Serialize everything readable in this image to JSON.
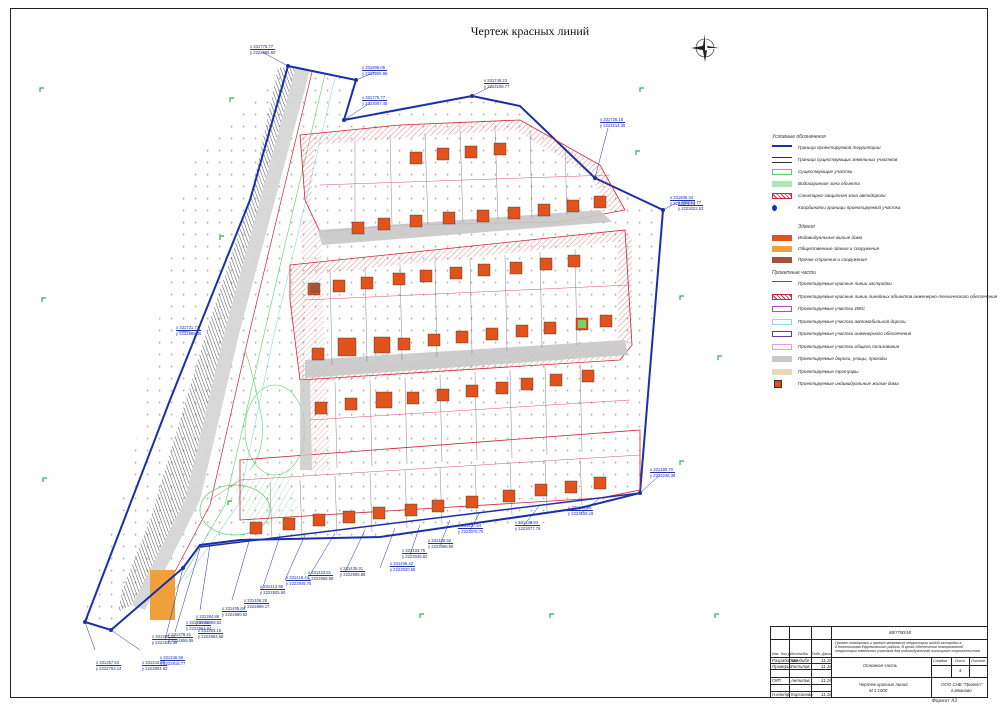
{
  "title": "Чертеж красных линий",
  "coords": [
    {
      "x": "x 331775.77",
      "y": "y 2222885.60"
    },
    {
      "x": "x 331806.06",
      "y": "y 2222906.96"
    },
    {
      "x": "x 331775.77",
      "y": "y 2223007.45"
    },
    {
      "x": "x 331749.23",
      "y": "y 2223108.77"
    },
    {
      "x": "x 331726.16",
      "y": "y 2223214.35"
    },
    {
      "x": "x 331606.34",
      "y": "y 2223271.71"
    },
    {
      "x": "x 331731.77",
      "y": "y 2222865.45"
    },
    {
      "x": "x 331480.70",
      "y": "y 2223246.38"
    },
    {
      "x": "x 331448.90",
      "y": "y 2223155.19"
    },
    {
      "x": "x 331436.94",
      "y": "y 2223077.75"
    },
    {
      "x": "x 331437.64",
      "y": "y 2223076.75"
    },
    {
      "x": "x 331436.92",
      "y": "y 2223056.59"
    },
    {
      "x": "x 331433.75",
      "y": "y 2223045.82"
    },
    {
      "x": "x 331436.42",
      "y": "y 2223020.55"
    },
    {
      "x": "x 331435.31",
      "y": "y 2222995.86"
    },
    {
      "x": "x 331423.81",
      "y": "y 2222968.88"
    },
    {
      "x": "x 331418.44",
      "y": "y 2222945.75"
    },
    {
      "x": "x 331413.98",
      "y": "y 2222925.60"
    },
    {
      "x": "x 331406.28",
      "y": "y 2222899.17"
    },
    {
      "x": "x 331405.84",
      "y": "y 2222880.52"
    },
    {
      "x": "x 331394.88",
      "y": "y 2222868.52"
    },
    {
      "x": "x 331391.94",
      "y": "y 2222864.84"
    },
    {
      "x": "x 331383.15",
      "y": "y 2222863.55"
    },
    {
      "x": "x 331378.41",
      "y": "y 2222859.55"
    },
    {
      "x": "x 331380.74",
      "y": "y 2222832.36"
    },
    {
      "x": "x 331346.56",
      "y": "y 2222816.77"
    },
    {
      "x": "x 331343.66",
      "y": "y 2222804.63"
    },
    {
      "x": "x 331357.53",
      "y": "y 2222763.14"
    },
    {
      "x": "x 331612.77",
      "y": "y 2223022.53"
    }
  ],
  "legend": {
    "heading_conditions": "Условные обозначения",
    "items_a": [
      "Граница проектируемой территории",
      "Граница существующих земельных участков",
      "Существующие участки",
      "Водоохранная зона объекта",
      "Санитарно-защитная зона автодороги",
      "Координаты границы проектируемой участка"
    ],
    "heading_buildings": "Здания",
    "items_b": [
      "Индивидуальные жилые дома",
      "Общественные здания и сооружения",
      "Прочие строения и сооружения"
    ],
    "heading_project": "Проектные части",
    "items_c": [
      "Проектируемые красные линии застройки",
      "Проектируемые красные линии линейных объектов инженерно-технического обеспечения",
      "Проектируемые участки ИЖС",
      "Проектируемые участки автомобильной дороги",
      "Проектируемые участки инженерного обеспечения",
      "Проектируемые участки общего пользования",
      "Проектируемые дороги, улицы, проезды",
      "Проектируемые тротуары",
      "Проектируемые индивидуальные жилые дома"
    ],
    "colors": {
      "boundary": "#1a2fa8",
      "red_line": "#d0253a",
      "house": "#e2531b",
      "public": "#f0a03a",
      "other": "#a0523a",
      "road": "#c8c8c8",
      "sidewalk": "#e8d7b8",
      "ijs": "#b04ad0",
      "auto_road": "#8fd6e6",
      "engineering": "#6a3aa0",
      "common": "#d8a0e8",
      "water": "#5ad06a"
    }
  },
  "stamp": {
    "code": "88/7790/18",
    "description": "Проект планировки и проект межевания территории жилой застройки в д.Колотиловка Ефремовского района. В целях обеспечения планировочной территории земельных участков для индивидуального жилищного строительства",
    "section": "Основная часть",
    "drawing": "Чертеж красных линий",
    "scale": "М 1:1000",
    "stage_label": "Стадия",
    "sheet_label": "Лист",
    "sheets_label": "Листов",
    "sheet_no": "4",
    "company": "ООО СНБ \"Проект\"",
    "city": "г.Иваново",
    "format": "Формат А3",
    "rows": [
      {
        "role": "Разработал",
        "name": "Миндибе",
        "date": "11.18"
      },
      {
        "role": "Проверил",
        "name": "Антипов",
        "date": "11.18"
      },
      {
        "role": "ГИП",
        "name": "Антипов",
        "date": "11.18"
      },
      {
        "role": "Н.контр.",
        "name": "Кирсанова",
        "date": "11.18"
      }
    ],
    "header_cells": [
      "Изм.",
      "Кол.уч",
      "Лист",
      "№док",
      "Подп.",
      "Дата"
    ]
  }
}
